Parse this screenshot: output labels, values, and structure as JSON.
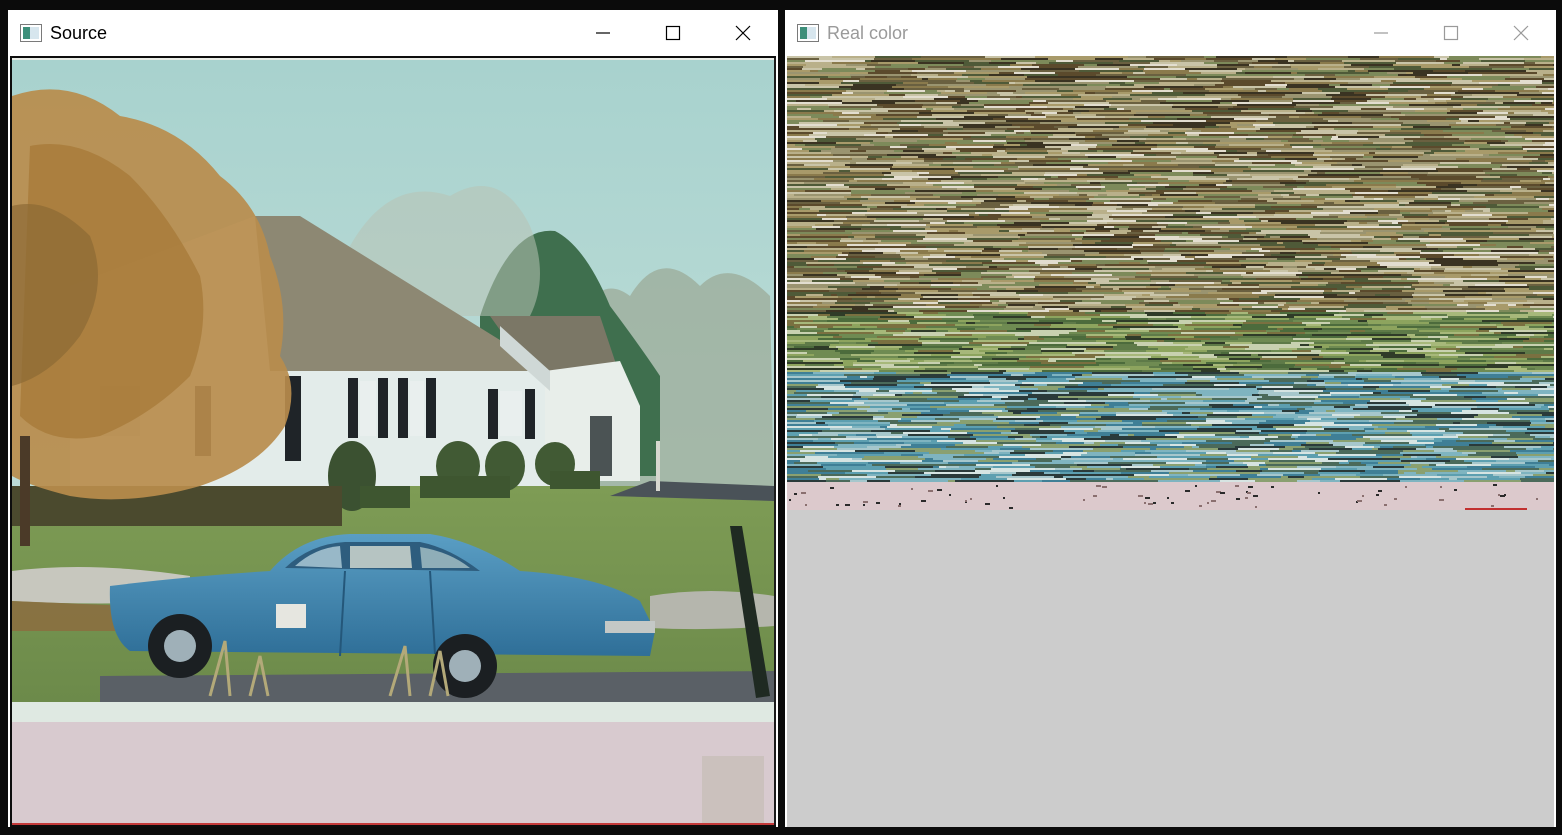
{
  "windows": [
    {
      "title": "Source",
      "active": true,
      "image": {
        "subject": "photo of white house with blue sedan parked on lawn",
        "colors": {
          "sky": "#b7d8d4",
          "lawn": "#7c9a55",
          "house": "#e2eceb",
          "roof": "#8c8672",
          "car": "#3f86b0",
          "tree": "#b88a48",
          "mat_bottom": "#d9ccd0"
        }
      }
    },
    {
      "title": "Real color",
      "active": false,
      "image": {
        "subject": "horizontally smeared scanline output",
        "colors": {
          "band_top": "#786f48",
          "band_mid": "#6f8b52",
          "band_blue": "#5d9fb0",
          "strip": "#dcc9cc",
          "background": "#cccccc"
        }
      }
    }
  ],
  "caption_icons": [
    "minimize-icon",
    "maximize-icon",
    "close-icon"
  ]
}
